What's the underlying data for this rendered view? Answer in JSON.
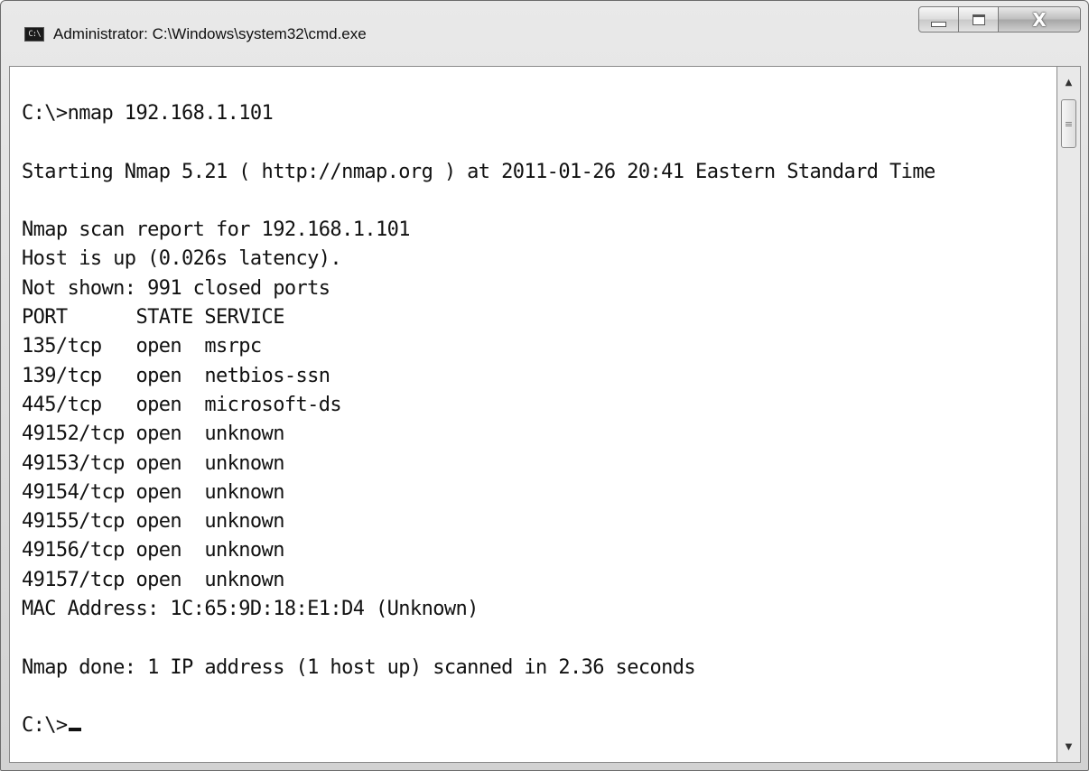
{
  "window": {
    "title": "Administrator: C:\\Windows\\system32\\cmd.exe",
    "icon": "cmd-icon",
    "icon_text": "C:\\",
    "close_glyph": "X"
  },
  "console": {
    "lines": [
      "C:\\>nmap 192.168.1.101",
      "",
      "Starting Nmap 5.21 ( http://nmap.org ) at 2011-01-26 20:41 Eastern Standard Time",
      "",
      "Nmap scan report for 192.168.1.101",
      "Host is up (0.026s latency).",
      "Not shown: 991 closed ports",
      "PORT      STATE SERVICE",
      "135/tcp   open  msrpc",
      "139/tcp   open  netbios-ssn",
      "445/tcp   open  microsoft-ds",
      "49152/tcp open  unknown",
      "49153/tcp open  unknown",
      "49154/tcp open  unknown",
      "49155/tcp open  unknown",
      "49156/tcp open  unknown",
      "49157/tcp open  unknown",
      "MAC Address: 1C:65:9D:18:E1:D4 (Unknown)",
      "",
      "Nmap done: 1 IP address (1 host up) scanned in 2.36 seconds",
      "",
      "C:\\>"
    ]
  },
  "scrollbar": {
    "up_glyph": "▲",
    "down_glyph": "▼",
    "thumb_glyph": "≡"
  }
}
